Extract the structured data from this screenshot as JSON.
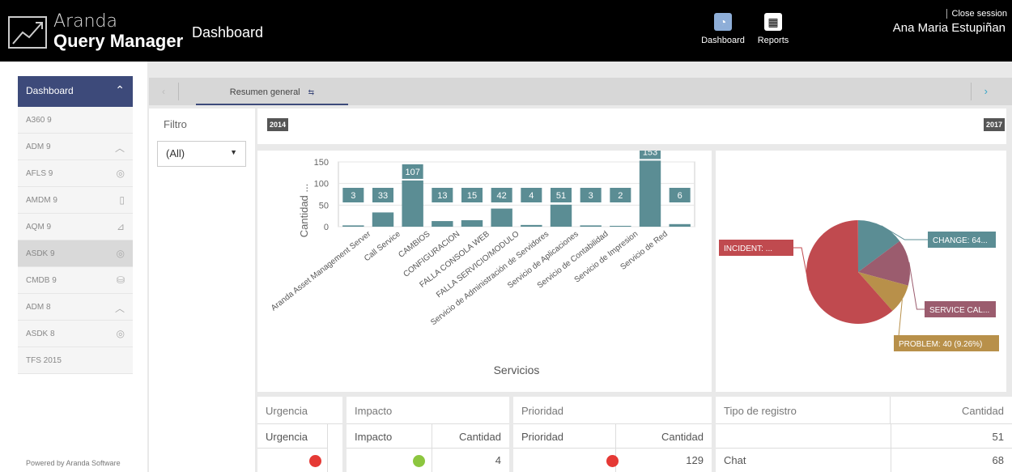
{
  "header": {
    "app_name_line1": "Aranda",
    "app_name_line2": "Query Manager",
    "page_title": "Dashboard",
    "nav": [
      {
        "label": "Dashboard",
        "icon": "pie-chart-icon",
        "active": true
      },
      {
        "label": "Reports",
        "icon": "report-icon",
        "active": false
      }
    ],
    "close_session": "Close session",
    "user_name": "Ana Maria Estupiñan"
  },
  "sidebar": {
    "header_label": "Dashboard",
    "items": [
      {
        "label": "A360 9",
        "icon": ""
      },
      {
        "label": "ADM 9",
        "icon": "chevron-up-icon"
      },
      {
        "label": "AFLS 9",
        "icon": "badge-icon"
      },
      {
        "label": "AMDM 9",
        "icon": "mobile-icon"
      },
      {
        "label": "AQM 9",
        "icon": "chart-icon"
      },
      {
        "label": "ASDK 9",
        "icon": "headset-icon"
      },
      {
        "label": "CMDB 9",
        "icon": "database-icon"
      },
      {
        "label": "ADM 8",
        "icon": "chevron-up-icon"
      },
      {
        "label": "ASDK 8",
        "icon": "headset-icon"
      },
      {
        "label": "TFS 2015",
        "icon": ""
      }
    ],
    "footer": "Powered by Aranda Software"
  },
  "tabs": {
    "active_label": "Resumen general"
  },
  "filter": {
    "label": "Filtro",
    "value": "(All)"
  },
  "year_range": {
    "start": "2014",
    "end": "2017"
  },
  "chart_data": [
    {
      "type": "bar",
      "xlabel": "Servicios",
      "ylabel": "Cantidad ...",
      "ylim": [
        0,
        150
      ],
      "yticks": [
        "0",
        "50",
        "100",
        "150"
      ],
      "grid": true,
      "categories": [
        "Aranda Asset Management Server",
        "Call Service",
        "CAMBIOS",
        "CONFIGURACION",
        "FALLA CONSOLA WEB",
        "FALLA SERVICIO/MODULO",
        "Servicio de Administración de Servidores",
        "Servicio de Aplicaciones",
        "Servicio de Contabilidad",
        "Servicio de Impresion",
        "Servicio de Red"
      ],
      "values": [
        3,
        33,
        107,
        13,
        15,
        42,
        4,
        51,
        3,
        2,
        153,
        6
      ],
      "labels": [
        "3",
        "33",
        "107",
        "13",
        "15",
        "42",
        "4",
        "51",
        "3",
        "2",
        "153",
        "6"
      ],
      "color": "#5b8d94"
    },
    {
      "type": "pie",
      "slices": [
        {
          "label": "INCIDENT: ...",
          "percent": 61.5,
          "color": "#c04a4f"
        },
        {
          "label": "CHANGE: 64...",
          "percent": 14.8,
          "color": "#5b8d94"
        },
        {
          "label": "SERVICE CAL...",
          "percent": 14.4,
          "color": "#9b5c6e"
        },
        {
          "label": "PROBLEM: 40 (9.26%)",
          "percent": 9.26,
          "color": "#b8904a"
        }
      ]
    }
  ],
  "tables": {
    "urgencia": {
      "title": "Urgencia",
      "column": "Urgencia",
      "row_dot_color": "#e53935"
    },
    "impacto": {
      "title": "Impacto",
      "columns": [
        "Impacto",
        "Cantidad"
      ],
      "row_dot_color": "#8cc63f",
      "row_value": "4"
    },
    "prioridad": {
      "title": "Prioridad",
      "columns": [
        "Prioridad",
        "Cantidad"
      ],
      "row_dot_color": "#e53935",
      "row_value": "129"
    },
    "tipo": {
      "columns": [
        "Tipo de registro",
        "Cantidad"
      ],
      "rows": [
        {
          "name": "",
          "value": "51"
        },
        {
          "name": "Chat",
          "value": "68"
        }
      ]
    }
  }
}
